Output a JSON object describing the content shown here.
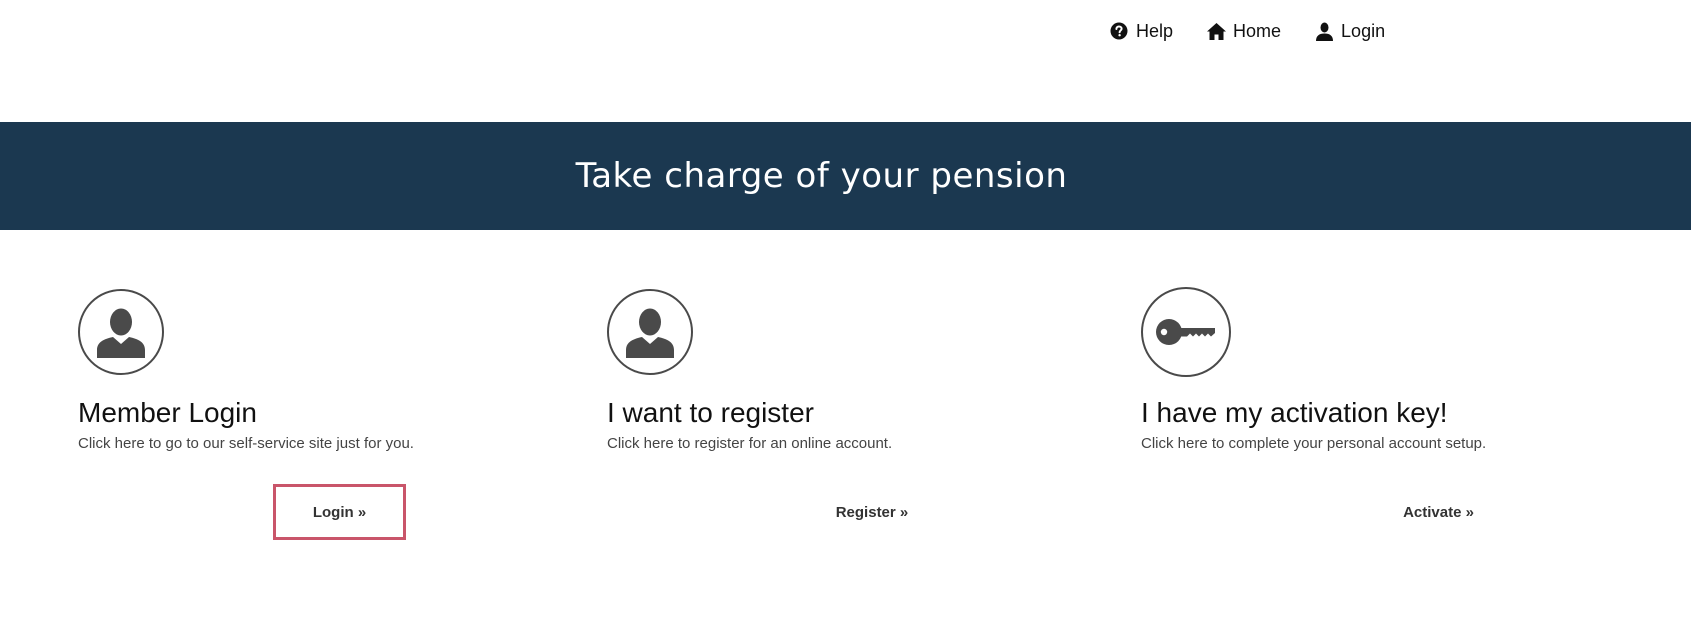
{
  "nav": {
    "help": {
      "label": "Help",
      "icon": "question-circle-icon"
    },
    "home": {
      "label": "Home",
      "icon": "home-icon"
    },
    "login": {
      "label": "Login",
      "icon": "user-icon"
    }
  },
  "banner": {
    "title": "Take charge of your pension",
    "background": "#1b3850"
  },
  "cards": [
    {
      "icon": "user-circle-icon",
      "title": "Member Login",
      "description": "Click here to go to our self-service site just for you.",
      "action": "Login »",
      "highlighted": true
    },
    {
      "icon": "user-circle-icon",
      "title": "I want to register",
      "description": "Click here to register for an online account.",
      "action": "Register »",
      "highlighted": false
    },
    {
      "icon": "key-circle-icon",
      "title": "I have my activation key!",
      "description": "Click here to complete your personal account setup.",
      "action": "Activate »",
      "highlighted": false
    }
  ],
  "colors": {
    "highlight_border": "#c9556a",
    "icon_gray": "#4a4a4a"
  }
}
